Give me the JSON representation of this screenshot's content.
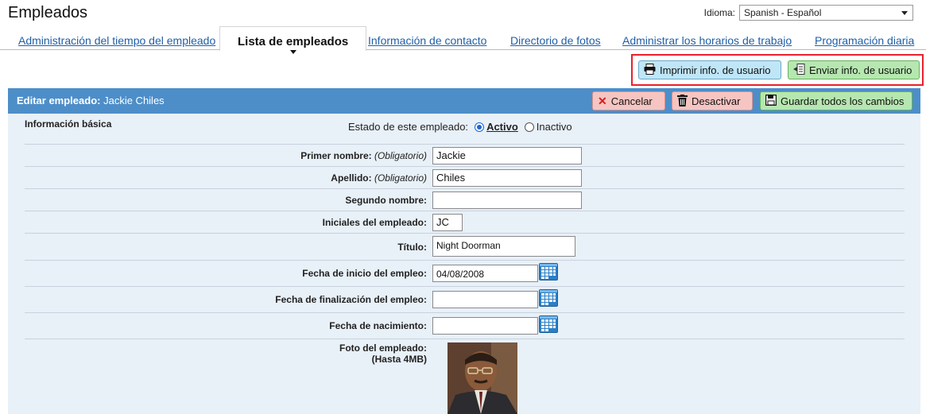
{
  "header": {
    "title": "Empleados",
    "language_label": "Idioma:",
    "language_value": "Spanish - Español"
  },
  "tabs": [
    {
      "label": "Administración del tiempo del empleado",
      "active": false
    },
    {
      "label": "Lista de empleados",
      "active": true
    },
    {
      "label": "Información de contacto",
      "active": false
    },
    {
      "label": "Directorio de fotos",
      "active": false
    },
    {
      "label": "Administrar los horarios de trabajo",
      "active": false
    },
    {
      "label": "Programación diaria",
      "active": false
    }
  ],
  "actions": {
    "print_label": "Imprimir info. de usuario",
    "send_label": "Enviar info. de usuario"
  },
  "panel": {
    "title_prefix": "Editar empleado:",
    "employee_name": "Jackie Chiles",
    "cancel_label": "Cancelar",
    "deactivate_label": "Desactivar",
    "save_label": "Guardar todos los cambios"
  },
  "form": {
    "section_title": "Información básica",
    "status_label": "Estado de este empleado:",
    "status_active": "Activo",
    "status_inactive": "Inactivo",
    "status_selected": "Activo",
    "required_note": "(Obligatorio)",
    "first_name_label": "Primer nombre:",
    "first_name_value": "Jackie",
    "last_name_label": "Apellido:",
    "last_name_value": "Chiles",
    "middle_name_label": "Segundo nombre:",
    "middle_name_value": "",
    "initials_label": "Iniciales del empleado:",
    "initials_value": "JC",
    "job_title_label": "Título:",
    "job_title_value": "Night Doorman",
    "start_date_label": "Fecha de inicio del empleo:",
    "start_date_value": "04/08/2008",
    "end_date_label": "Fecha de finalización del empleo:",
    "end_date_value": "",
    "birth_date_label": "Fecha de nacimiento:",
    "birth_date_value": "",
    "photo_label_line1": "Foto del empleado:",
    "photo_label_line2": "(Hasta 4MB)"
  },
  "colors": {
    "panel_header": "#4d8ec9",
    "panel_body": "#e8f0f8",
    "highlight_border": "#e8202c",
    "link": "#1f5fa8"
  }
}
